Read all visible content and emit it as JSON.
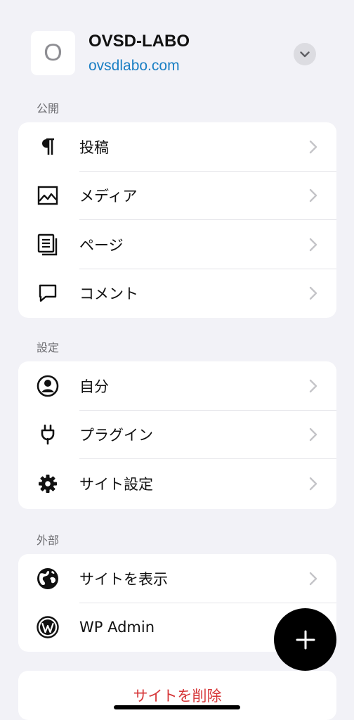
{
  "site": {
    "avatar_letter": "O",
    "title": "OVSD-LABO",
    "url": "ovsdlabo.com"
  },
  "sections": {
    "publish": {
      "header": "公開",
      "items": [
        {
          "label": "投稿",
          "icon": "pilcrow-icon"
        },
        {
          "label": "メディア",
          "icon": "image-icon"
        },
        {
          "label": "ページ",
          "icon": "pages-icon"
        },
        {
          "label": "コメント",
          "icon": "comment-icon"
        }
      ]
    },
    "settings": {
      "header": "設定",
      "items": [
        {
          "label": "自分",
          "icon": "person-icon"
        },
        {
          "label": "プラグイン",
          "icon": "plug-icon"
        },
        {
          "label": "サイト設定",
          "icon": "gear-icon"
        }
      ]
    },
    "external": {
      "header": "外部",
      "items": [
        {
          "label": "サイトを表示",
          "icon": "globe-icon"
        },
        {
          "label": "WP Admin",
          "icon": "wordpress-icon"
        }
      ]
    }
  },
  "danger": {
    "label": "サイトを削除"
  },
  "colors": {
    "background": "#f2f2f7",
    "link": "#1a7fc4",
    "danger": "#d63638",
    "fab": "#000000"
  }
}
